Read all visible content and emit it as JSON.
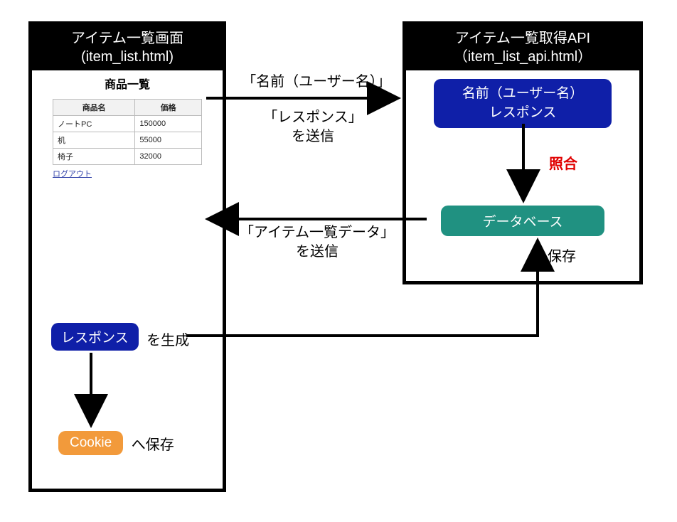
{
  "left": {
    "title_line1": "アイテム一覧画面",
    "title_line2": "(item_list.html)",
    "preview_heading": "商品一覧",
    "table": {
      "headers": [
        "商品名",
        "価格"
      ],
      "rows": [
        [
          "ノートPC",
          "150000"
        ],
        [
          "机",
          "55000"
        ],
        [
          "椅子",
          "32000"
        ]
      ]
    },
    "logout": "ログアウト",
    "response_label": "レスポンス",
    "generate_suffix": " を生成",
    "cookie_label": "Cookie",
    "cookie_suffix": " へ保存"
  },
  "right": {
    "title_line1": "アイテム一覧取得API",
    "title_line2": "（item_list_api.html）",
    "input_line1": "名前（ユーザー名）",
    "input_line2": "レスポンス",
    "verify": "照合",
    "database": "データベース",
    "save": "保存"
  },
  "arrows": {
    "send_name": "「名前（ユーザー名）」",
    "send_resp_l1": "「レスポンス」",
    "send_resp_l2": "を送信",
    "return_l1": "「アイテム一覧データ」",
    "return_l2": "を送信"
  }
}
